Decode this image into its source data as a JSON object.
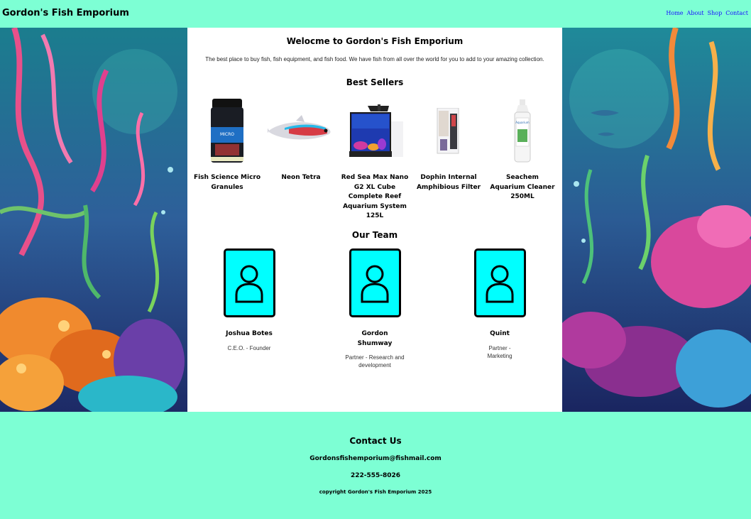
{
  "header": {
    "site_title": "Gordon's Fish Emporium",
    "nav": [
      "Home",
      "About",
      "Shop",
      "Contact"
    ]
  },
  "main": {
    "welcome_title": "Welocme to Gordon's Fish Emporium",
    "welcome_text": "The best place to buy fish, fish equipment, and fish food. We have fish from all over the world for you to add to your amazing collection.",
    "best_sellers_title": "Best Sellers",
    "products": [
      {
        "name": "Fish Science Micro Granules",
        "image": "micro-granules-jar-image"
      },
      {
        "name": "Neon Tetra",
        "image": "neon-tetra-fish-image"
      },
      {
        "name": "Red Sea Max Nano G2 XL Cube Complete Reef Aquarium System 125L",
        "image": "reef-aquarium-image"
      },
      {
        "name": "Dophin Internal Amphibious Filter",
        "image": "internal-filter-image"
      },
      {
        "name": "Seachem Aquarium Cleaner 250ML",
        "image": "aquarium-cleaner-bottle-image"
      }
    ],
    "team_title": "Our Team",
    "team": [
      {
        "name": "Joshua Botes",
        "role": "C.E.O. - Founder"
      },
      {
        "name": "Gordon Shumway",
        "role": "Partner - Research and development"
      },
      {
        "name": "Quint",
        "role": "Partner - Marketing"
      }
    ]
  },
  "footer": {
    "contact_title": "Contact Us",
    "email": "Gordonsfishemporium@fishmail.com",
    "phone": "222-555-8026",
    "copyright": "copyright Gordon's Fish Emporium 2025"
  },
  "colors": {
    "header_bg": "#7dffd4",
    "avatar_bg": "#00ffff",
    "nav_link": "#1a0dff"
  }
}
